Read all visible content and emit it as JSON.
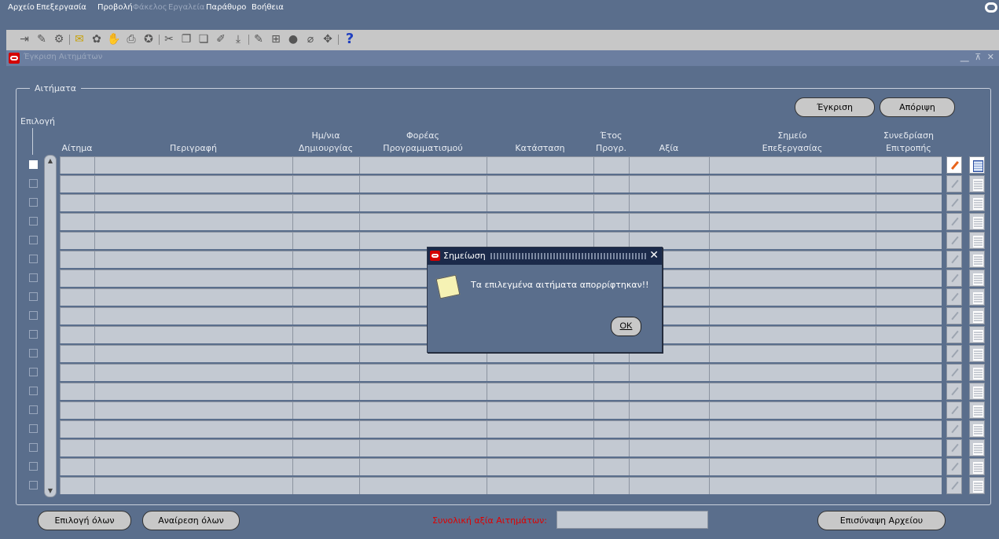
{
  "menu": {
    "items": [
      {
        "label": "Αρχείο",
        "enabled": true
      },
      {
        "label": "Επεξεργασία",
        "enabled": true
      },
      {
        "label": "Προβολή",
        "enabled": true
      },
      {
        "label": "Φάκελος",
        "enabled": false
      },
      {
        "label": "Εργαλεία",
        "enabled": false
      },
      {
        "label": "Παράθυρο",
        "enabled": true
      },
      {
        "label": "Βοήθεια",
        "enabled": true
      }
    ]
  },
  "toolbar": {
    "icons": [
      "new-icon",
      "open-icon",
      "navigate-icon",
      "save-icon",
      "translate-icon",
      "clear-icon",
      "print-icon",
      "find-icon",
      "cut-icon",
      "copy-icon",
      "paste-icon",
      "new-record-icon",
      "delete-record-icon",
      "edit-icon",
      "folder-tools-icon",
      "record-icon",
      "attachment-icon",
      "zoom-icon",
      "help-icon"
    ],
    "help_glyph": "?"
  },
  "window": {
    "title": "Έγκριση Αιτημάτων",
    "controls": "⎽ ⊼ ✕"
  },
  "form": {
    "frame_title": "Αιτήματα",
    "approve_button": "Έγκριση",
    "reject_button": "Απόριψη",
    "select_label": "Επιλογή",
    "columns": {
      "request": "Αίτημα",
      "description": "Περιγραφή",
      "date_line1": "Ημ/νια",
      "date_line2": "Δημιουργίας",
      "agency_line1": "Φορέας",
      "agency_line2": "Προγραμματισμού",
      "status": "Κατάσταση",
      "year_line1": "Έτος",
      "year_line2": "Προγρ.",
      "value": "Αξία",
      "point_line1": "Σημείο",
      "point_line2": "Επεξεργασίας",
      "committee_line1": "Συνεδρίαση",
      "committee_line2": "Επιτροπής"
    },
    "row_count": 18,
    "select_all_button": "Επιλογή όλων",
    "deselect_all_button": "Αναίρεση όλων",
    "total_label": "Συνολική αξία Αιτημάτων:",
    "total_value": "",
    "attach_button": "Επισύναψη Αρχείου"
  },
  "dialog": {
    "title": "Σημείωση",
    "message": "Τα επιλεγμένα αιτήματα απορρίφτηκαν!!",
    "ok_label": "OK"
  },
  "colors": {
    "background": "#5a6e8c",
    "field": "#c3c9d2",
    "total_label": "#e00000",
    "oracle_red": "#d40000"
  }
}
